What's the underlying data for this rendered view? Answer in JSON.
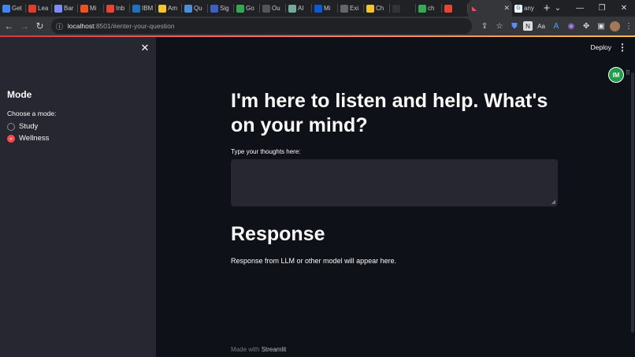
{
  "browser": {
    "tabs": [
      {
        "label": "Get",
        "icon": "google-drive-icon",
        "color": "#4285f4"
      },
      {
        "label": "Lea",
        "icon": "lea-icon",
        "color": "#e33b2e"
      },
      {
        "label": "Bar",
        "icon": "bard-icon",
        "color": "#7b8cff"
      },
      {
        "label": "Mi",
        "icon": "microsoft-icon",
        "color": "#f25022"
      },
      {
        "label": "Inb",
        "icon": "gmail-icon",
        "color": "#ea4335"
      },
      {
        "label": "IBM",
        "icon": "ibm-icon",
        "color": "#1f70c1"
      },
      {
        "label": "Am",
        "icon": "hugging-face-icon",
        "color": "#f7c52b"
      },
      {
        "label": "Qu",
        "icon": "quillbot-icon",
        "color": "#4a90d9"
      },
      {
        "label": "Sig",
        "icon": "sign-icon",
        "color": "#3b5fc4"
      },
      {
        "label": "Go",
        "icon": "google-icon",
        "color": "#34a853"
      },
      {
        "label": "Ou",
        "icon": "star-icon",
        "color": "#555555"
      },
      {
        "label": "AI",
        "icon": "chatgpt-icon",
        "color": "#74aa9c"
      },
      {
        "label": "Mi",
        "icon": "mail-icon",
        "color": "#0a5bd6"
      },
      {
        "label": "Exi",
        "icon": "exit-icon",
        "color": "#666666"
      },
      {
        "label": "Ch",
        "icon": "hugging-face-icon",
        "color": "#f7c52b"
      },
      {
        "label": "",
        "icon": "github-icon",
        "color": "#333333"
      },
      {
        "label": "ch",
        "icon": "chrome-icon",
        "color": "#34a853"
      },
      {
        "label": "",
        "icon": "record-icon",
        "color": "#ea4335"
      }
    ],
    "active_tab": {
      "label": "",
      "icon": "streamlit-icon",
      "close": "✕"
    },
    "last_tab": {
      "label": "any",
      "icon": "google-icon",
      "color": "#4285f4"
    },
    "new_tab": "+",
    "url_host": "localhost",
    "url_path": ":8501/#enter-your-question"
  },
  "sidebar": {
    "close": "✕",
    "mode_title": "Mode",
    "choose_label": "Choose a mode:",
    "options": [
      {
        "label": "Study",
        "selected": false
      },
      {
        "label": "Wellness",
        "selected": true
      }
    ]
  },
  "header": {
    "deploy_label": "Deploy",
    "menu_icon": "⋮"
  },
  "extension": {
    "badge": "IM"
  },
  "main": {
    "heading": "I'm here to listen and help. What's on your mind?",
    "input_label": "Type your thoughts here:",
    "input_value": "",
    "response_heading": "Response",
    "response_text": "Response from LLM or other model will appear here."
  },
  "footer": {
    "prefix": "Made with ",
    "brand": "Streamlit"
  },
  "colors": {
    "accent": "#ff4b4b",
    "background": "#0e1117",
    "sidebar": "#262730"
  }
}
